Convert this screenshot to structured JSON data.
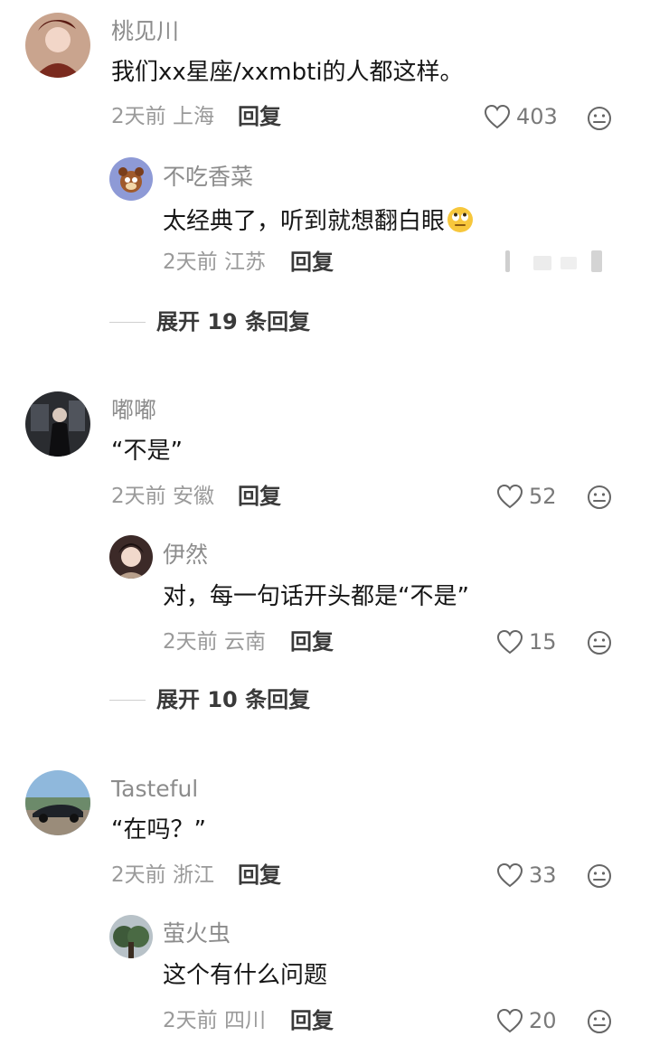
{
  "comments": [
    {
      "name": "桃见川",
      "text": "我们xx星座/xxmbti的人都这样。",
      "time": "2天前",
      "location": "上海",
      "reply_label": "回复",
      "likes": "403",
      "replies": [
        {
          "name": "不吃香菜",
          "text": "太经典了，听到就想翻白眼",
          "emoji": "eye-roll-emoji",
          "time": "2天前",
          "location": "江苏",
          "reply_label": "回复"
        }
      ],
      "expand_label": "展开 19 条回复"
    },
    {
      "name": "嘟嘟",
      "text": "“不是”",
      "time": "2天前",
      "location": "安徽",
      "reply_label": "回复",
      "likes": "52",
      "replies": [
        {
          "name": "伊然",
          "text": "对，每一句话开头都是“不是”",
          "time": "2天前",
          "location": "云南",
          "reply_label": "回复",
          "likes": "15"
        }
      ],
      "expand_label": "展开 10 条回复"
    },
    {
      "name": "Tasteful",
      "text": "“在吗？”",
      "time": "2天前",
      "location": "浙江",
      "reply_label": "回复",
      "likes": "33",
      "replies": [
        {
          "name": "萤火虫",
          "text": "这个有什么问题",
          "time": "2天前",
          "location": "四川",
          "reply_label": "回复",
          "likes": "20"
        }
      ]
    }
  ],
  "icons": {
    "like": "heart-outline-icon",
    "reaction": "neutral-face-icon"
  },
  "colors": {
    "name": "#8c8c8c",
    "meta": "#9a9a9a",
    "text": "#161616"
  }
}
